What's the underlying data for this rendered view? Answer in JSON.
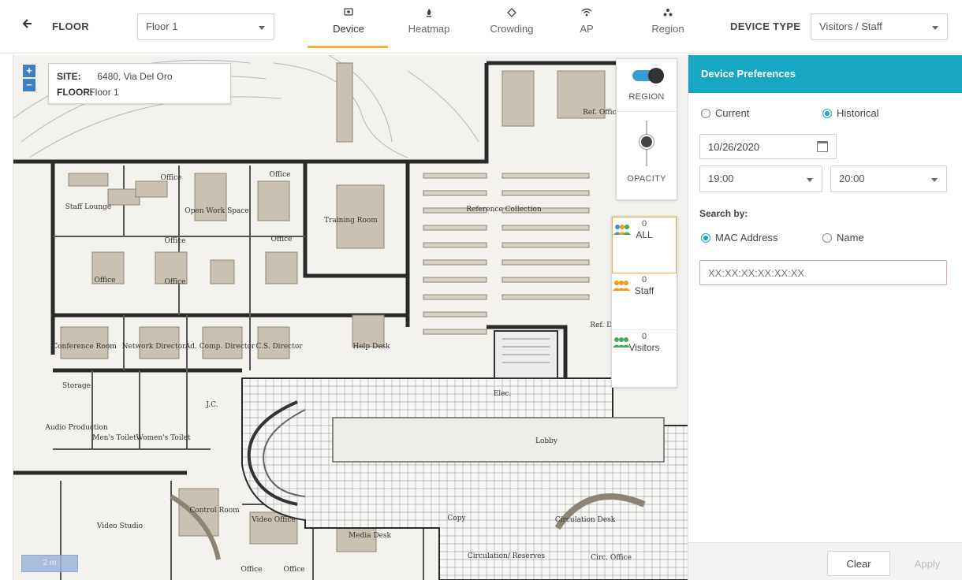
{
  "toolbar": {
    "back_icon": "back-arrow-icon",
    "floor_label": "FLOOR",
    "floor_value": "Floor 1",
    "device_type_label": "DEVICE TYPE",
    "device_type_value": "Visitors / Staff",
    "tabs": [
      {
        "label": "Device",
        "icon": "device-icon",
        "active": true
      },
      {
        "label": "Heatmap",
        "icon": "heatmap-icon",
        "active": false
      },
      {
        "label": "Crowding",
        "icon": "crowding-icon",
        "active": false
      },
      {
        "label": "AP",
        "icon": "wifi-icon",
        "active": false
      },
      {
        "label": "Region",
        "icon": "region-icon",
        "active": false
      }
    ],
    "accent_color": "#f5b13d"
  },
  "map": {
    "site_key": "SITE:",
    "site_value": "6480, Via Del Oro",
    "floor_key": "FLOOR:",
    "floor_value": "Floor 1",
    "zoom_in": "+",
    "zoom_out": "−",
    "scale": "2 m",
    "region_label": "REGION",
    "region_enabled": true,
    "opacity_label": "OPACITY",
    "filters": [
      {
        "count": "0",
        "name": "ALL",
        "colors": [
          "#3a8fd9",
          "#f39a1e",
          "#49a85a"
        ]
      },
      {
        "count": "0",
        "name": "Staff",
        "colors": [
          "#f39a1e"
        ]
      },
      {
        "count": "0",
        "name": "Visitors",
        "colors": [
          "#49a85a"
        ]
      }
    ],
    "room_labels": [
      "Staff Lounge",
      "Office",
      "Office",
      "Open Work Space",
      "Office",
      "Office",
      "Office",
      "Office",
      "Training Room",
      "Reference Collection",
      "Ref. Office",
      "Conference Room",
      "Network Director",
      "Ad. Comp. Director",
      "C.S. Director",
      "Help Desk",
      "Ref. De",
      "Storage",
      "Audio Production",
      "Men's Toilet",
      "Women's Toilet",
      "J.C.",
      "Elec.",
      "Lobby",
      "Video Studio",
      "Control Room",
      "Video Office",
      "Media Desk",
      "Copy",
      "Circulation Desk",
      "Circulation/ Reserves",
      "Circ. Office",
      "Office",
      "Office"
    ]
  },
  "panel": {
    "title": "Device Preferences",
    "accent_color": "#17a7c2",
    "mode_current": "Current",
    "mode_historical": "Historical",
    "date": "10/26/2020",
    "time_from": "19:00",
    "time_to": "20:00",
    "search_by_label": "Search by:",
    "search_mac": "MAC Address",
    "search_name": "Name",
    "mac_placeholder": "XX:XX:XX:XX:XX:XX",
    "clear_label": "Clear",
    "apply_label": "Apply"
  }
}
